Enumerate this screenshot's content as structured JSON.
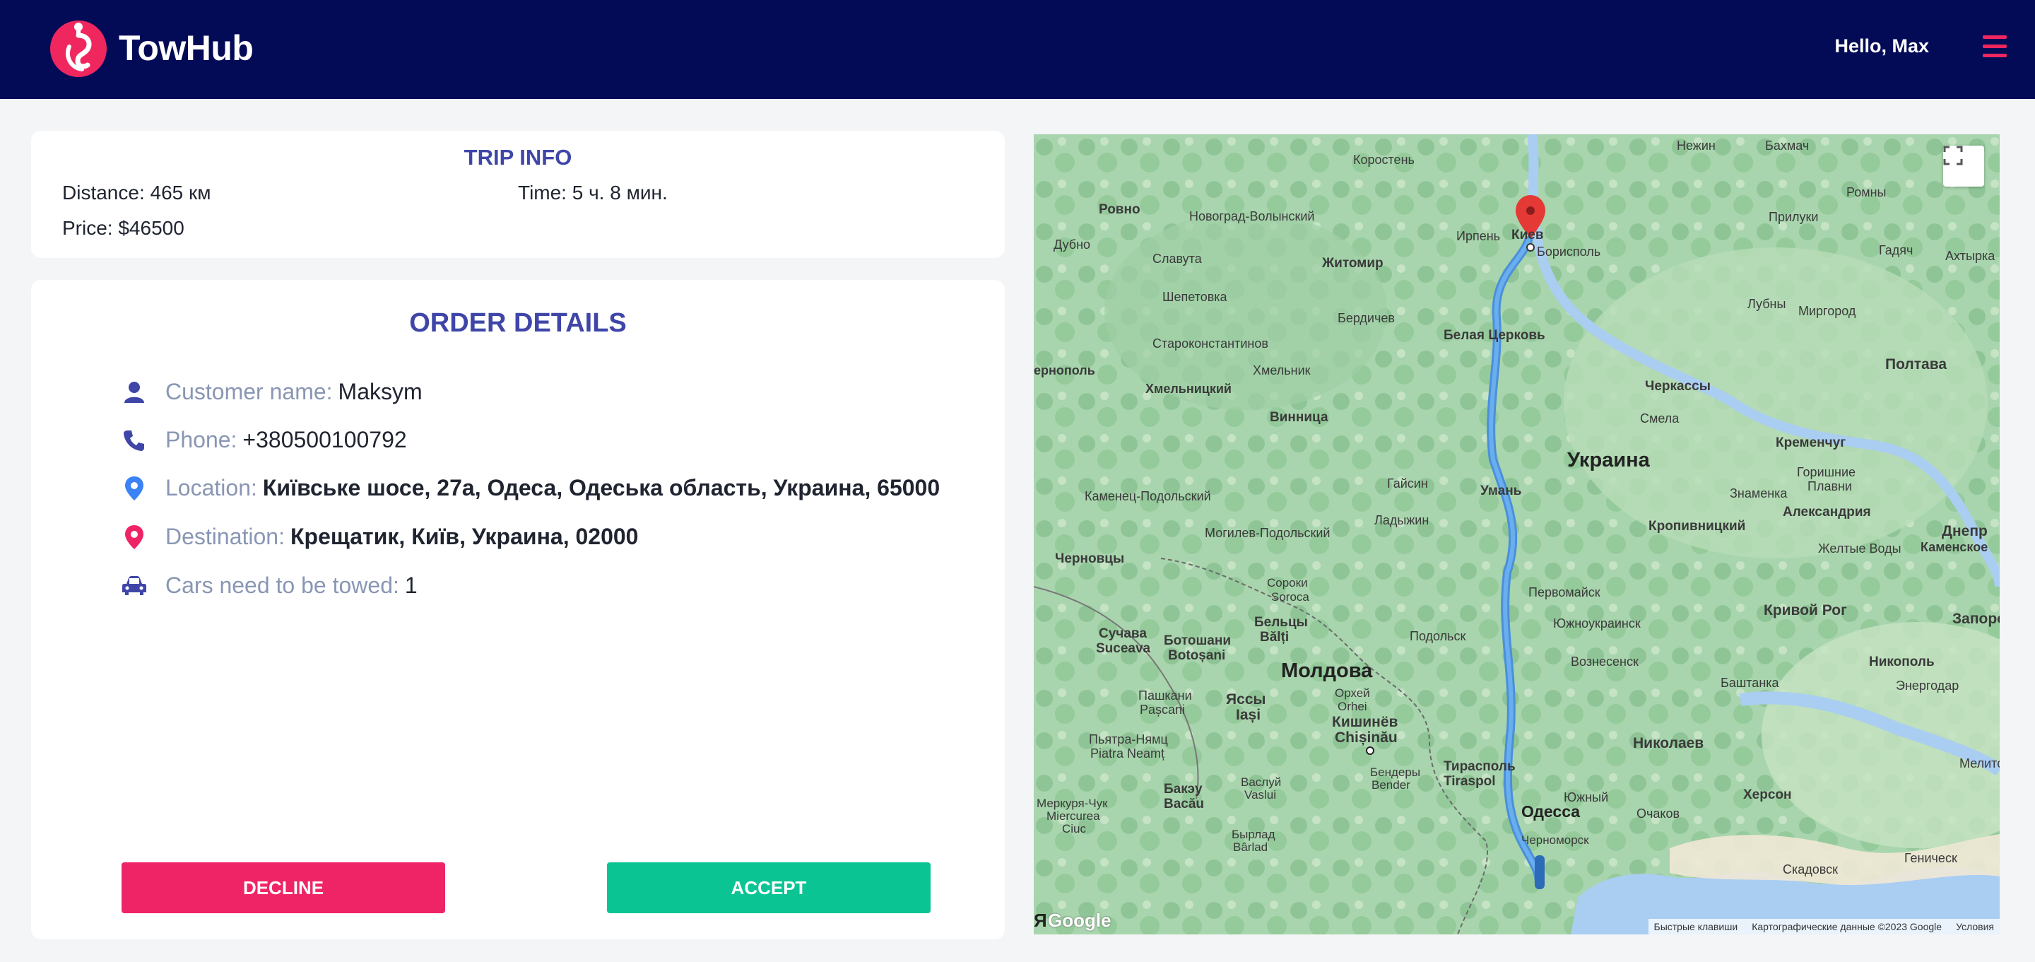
{
  "header": {
    "brand": "TowHub",
    "greeting": "Hello, Max",
    "colors": {
      "background": "#030b57",
      "accent": "#f0265f"
    }
  },
  "trip_info": {
    "title": "TRIP INFO",
    "distance": "Distance: 465 км",
    "time": "Time: 5 ч. 8 мин.",
    "price": "Price: $46500"
  },
  "order_details": {
    "title": "ORDER DETAILS",
    "rows": [
      {
        "icon": "person-icon",
        "label": "Customer name:",
        "value": "Maksym"
      },
      {
        "icon": "phone-icon",
        "label": "Phone:",
        "value": "+380500100792"
      },
      {
        "icon": "location-pin-icon",
        "label": "Location:",
        "value": "Київське шосе, 27а, Одеса, Одеська область, Украина, 65000"
      },
      {
        "icon": "destination-pin-icon",
        "label": "Destination:",
        "value": "Крещатик, Київ, Украина, 02000"
      },
      {
        "icon": "car-icon",
        "label": "Cars need to be towed:",
        "value": "1"
      }
    ],
    "decline_label": "DECLINE",
    "accept_label": "ACCEPT"
  },
  "map": {
    "fullscreen_icon": "fullscreen-icon",
    "google_label": "Google",
    "yandex_label": "Я",
    "footer": {
      "shortcuts": "Быстрые клавиши",
      "copyright": "Картографические данные ©2023 Google",
      "terms": "Условия"
    },
    "labels": {
      "korosten": "Коростень",
      "nezhin": "Нежин",
      "bakhmach": "Бахмач",
      "rovno": "Ровно",
      "novograd": "Новоград-Волынский",
      "irpen": "Ирпень",
      "kiev": "Киев",
      "priluki": "Прилуки",
      "romny": "Ромны",
      "dubno": "Дубно",
      "slavuta": "Славута",
      "zhitomir": "Житомир",
      "borispol": "Борисполь",
      "gadyach": "Гадяч",
      "akhtyrka": "Ахтырка",
      "shepetovka": "Шепетовка",
      "berdichev": "Бердичев",
      "lubny": "Лубны",
      "mirgorod": "Миргород",
      "belaya": "Белая Церковь",
      "starokonst": "Староконстантинов",
      "poltava": "Полтава",
      "ternopol": "ернополь",
      "khmelnik": "Хмельник",
      "khmelnitsky": "Хмельницкий",
      "cherkassy": "Черкассы",
      "vinnitsa": "Винница",
      "smela": "Смела",
      "kremenchug": "Кременчуг",
      "ukraine": "Украина",
      "gorishnie": "Горишние",
      "plavni": "Плавни",
      "kamenets": "Каменец-Подольский",
      "gaysin": "Гайсин",
      "uman": "Умань",
      "znamenka": "Знаменка",
      "aleksandria": "Александрия",
      "ladyzhin": "Ладыжин",
      "mogilev": "Могилев-Подольский",
      "kropyvnytskyi": "Кропивницкий",
      "dnepr": "Днепр",
      "kamenskoe": "Каменское",
      "chernovtsy": "Черновцы",
      "zheltye": "Желтые Воды",
      "soroki": "Сороки",
      "soroca": "Soroca",
      "pervomaisk": "Первомайск",
      "krivoy": "Кривой Рог",
      "zaporozh": "Запорож",
      "suchava": "Сучава",
      "suceava": "Suceava",
      "botoshani": "Ботошани",
      "botosani": "Botoșani",
      "beltsy": "Бельцы",
      "balti": "Bălți",
      "yuzhnoukr": "Южноукраинск",
      "podolsk": "Подольск",
      "voznesensk": "Вознесенск",
      "nikopol": "Никополь",
      "energodar": "Энергодар",
      "moldova": "Молдова",
      "orkhei": "Орхей",
      "orhei": "Orhei",
      "bashtanka": "Баштанка",
      "pashkany": "Пашкани",
      "pascani": "Pașcani",
      "yassy": "Яссы",
      "iasi": "Iași",
      "kishinev": "Кишинёв",
      "chisinau": "Chișinău",
      "nikolaev": "Николаев",
      "piatra": "Пьятра-Нямц",
      "piatraneamt": "Piatra Neamț",
      "tiraspol_ru": "Тирасполь",
      "tiraspol": "Tiraspol",
      "melito": "Мелито",
      "bendery": "Бендеры",
      "bender": "Bender",
      "bakeu": "Бакэу",
      "bacau": "Bacău",
      "vaslui_ru": "Васлуй",
      "vaslui": "Vaslui",
      "yuzhny": "Южный",
      "kherson": "Херсон",
      "miercurea_ru": "Меркуря-Чук",
      "miercurea": "Miercurea",
      "ciuc": "Ciuc",
      "odessa": "Одесса",
      "ochakov": "Очаков",
      "genichesk": "Геническ",
      "barlad_ru": "Бырлад",
      "barlad": "Bârlad",
      "chernomorsk": "Черноморск",
      "skadovsk": "Скадовск"
    }
  }
}
